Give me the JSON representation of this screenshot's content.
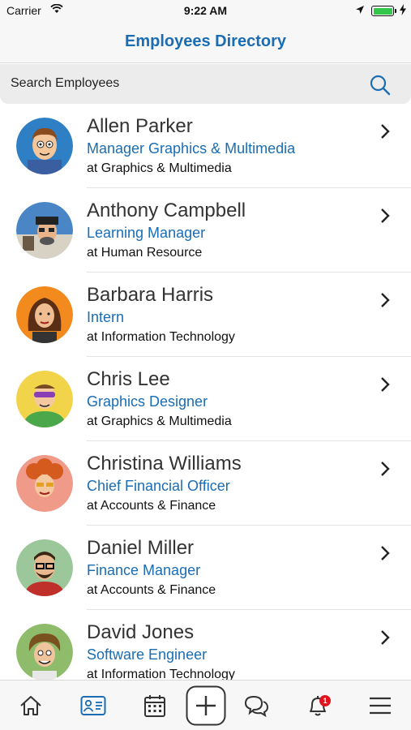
{
  "status_bar": {
    "carrier": "Carrier",
    "time": "9:22 AM"
  },
  "header": {
    "title": "Employees Directory"
  },
  "search": {
    "label": "Search Employees"
  },
  "employees": [
    {
      "name": "Allen Parker",
      "title": "Manager Graphics & Multimedia",
      "dept": "at Graphics & Multimedia",
      "avatar_bg": "#2e7fc4"
    },
    {
      "name": "Anthony Campbell",
      "title": "Learning Manager",
      "dept": "at Human Resource",
      "avatar_bg": "#4a86c6"
    },
    {
      "name": "Barbara Harris",
      "title": "Intern",
      "dept": "at Information Technology",
      "avatar_bg": "#f28a1e"
    },
    {
      "name": "Chris Lee",
      "title": "Graphics Designer",
      "dept": "at Graphics & Multimedia",
      "avatar_bg": "#f2d44a"
    },
    {
      "name": "Christina Williams",
      "title": "Chief Financial Officer",
      "dept": "at Accounts & Finance",
      "avatar_bg": "#f09a8a"
    },
    {
      "name": "Daniel Miller",
      "title": "Finance Manager",
      "dept": "at Accounts & Finance",
      "avatar_bg": "#9cc79a"
    },
    {
      "name": "David Jones",
      "title": "Software Engineer",
      "dept": "at Information Technology",
      "avatar_bg": "#8fbc6a"
    }
  ],
  "tab_bar": {
    "items": [
      "home-icon",
      "contacts-icon",
      "calendar-icon",
      "add-icon",
      "chat-icon",
      "bell-icon",
      "menu-icon"
    ],
    "notification_count": "1"
  },
  "colors": {
    "accent": "#1a6db3",
    "badge": "#e1141e"
  }
}
